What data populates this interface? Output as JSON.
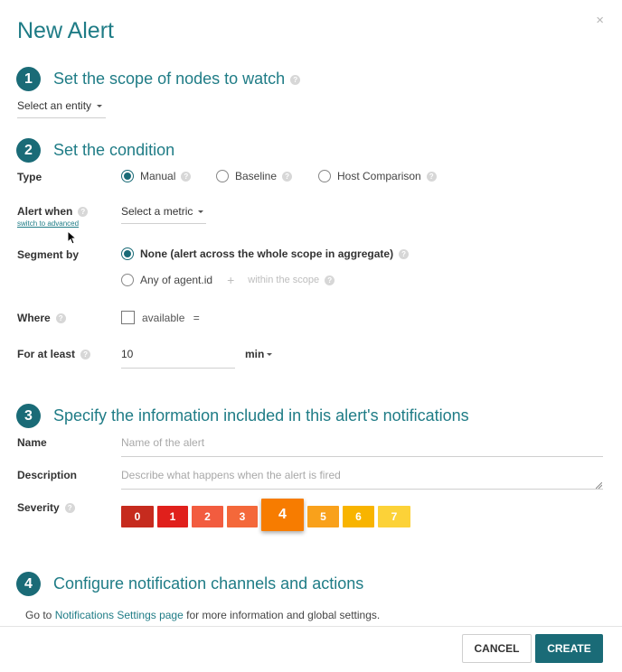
{
  "dialog": {
    "title": "New Alert",
    "close_glyph": "×"
  },
  "steps": [
    {
      "num": "1",
      "title": "Set the scope of nodes to watch"
    },
    {
      "num": "2",
      "title": "Set the condition"
    },
    {
      "num": "3",
      "title": "Specify the information included in this alert's notifications"
    },
    {
      "num": "4",
      "title": "Configure notification channels and actions"
    }
  ],
  "scope": {
    "entity_select": "Select an entity"
  },
  "condition": {
    "type_label": "Type",
    "type_options": [
      "Manual",
      "Baseline",
      "Host Comparison"
    ],
    "type_selected": "Manual",
    "alert_when_label": "Alert when",
    "switch_link": "switch to advanced",
    "metric_select": "Select a metric",
    "segment_label": "Segment by",
    "segment_option_none": "None (alert across the whole scope in aggregate)",
    "segment_option_any": "Any of agent.id",
    "segment_plus": "+",
    "segment_within": "within the scope",
    "where_label": "Where",
    "where_field": "available",
    "where_op": "=",
    "for_at_least_label": "For at least",
    "for_at_least_value": "10",
    "unit_select": "min"
  },
  "notification_info": {
    "name_label": "Name",
    "name_placeholder": "Name of the alert",
    "description_label": "Description",
    "description_placeholder": "Describe what happens when the alert is fired",
    "severity_label": "Severity",
    "severity_levels": [
      "0",
      "1",
      "2",
      "3",
      "4",
      "5",
      "6",
      "7"
    ],
    "severity_selected": "4",
    "severity_colors": [
      "#c62b1e",
      "#e0201c",
      "#f25c3f",
      "#f4683a",
      "#f77c00",
      "#f9a11b",
      "#f8b400",
      "#fcd238"
    ]
  },
  "channels": {
    "prefix": "Go to ",
    "link": "Notifications Settings page",
    "suffix": " for more information and global settings."
  },
  "footer": {
    "cancel": "CANCEL",
    "create": "CREATE"
  },
  "icons": {
    "help": "question-mark-icon",
    "caret": "caret-down-icon",
    "cursor": "mouse-pointer-icon"
  }
}
